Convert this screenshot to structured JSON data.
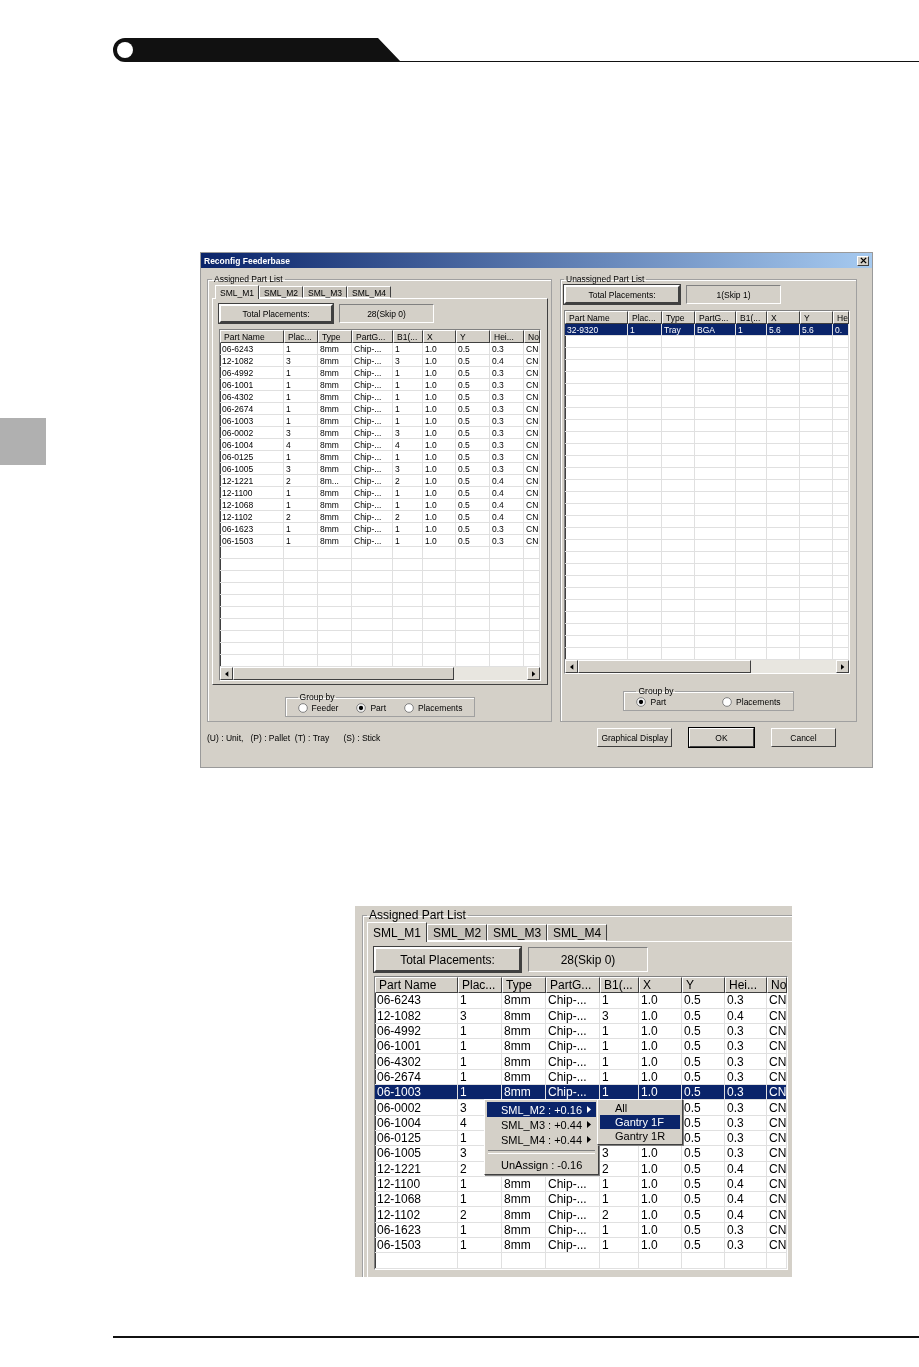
{
  "dialog": {
    "title": "Reconfig Feederbase",
    "assigned": {
      "legend": "Assigned Part List",
      "tabs": [
        {
          "label": "SML_M1",
          "selected": true
        },
        {
          "label": "SML_M2",
          "selected": false
        },
        {
          "label": "SML_M3",
          "selected": false
        },
        {
          "label": "SML_M4",
          "selected": false
        }
      ],
      "total_label": "Total Placements:",
      "total_value": "28(Skip 0)",
      "table": {
        "columns": [
          "Part Name",
          "Plac...",
          "Type",
          "PartG...",
          "B1(...",
          "X",
          "Y",
          "Hei...",
          "No"
        ],
        "rows": [
          {
            "cells": [
              "06-6243",
              "1",
              "8mm",
              "Chip-...",
              "1",
              "1.0",
              "0.5",
              "0.3",
              "CN"
            ],
            "selected": false
          },
          {
            "cells": [
              "12-1082",
              "3",
              "8mm",
              "Chip-...",
              "3",
              "1.0",
              "0.5",
              "0.4",
              "CN"
            ],
            "selected": false
          },
          {
            "cells": [
              "06-4992",
              "1",
              "8mm",
              "Chip-...",
              "1",
              "1.0",
              "0.5",
              "0.3",
              "CN"
            ],
            "selected": false
          },
          {
            "cells": [
              "06-1001",
              "1",
              "8mm",
              "Chip-...",
              "1",
              "1.0",
              "0.5",
              "0.3",
              "CN"
            ],
            "selected": false
          },
          {
            "cells": [
              "06-4302",
              "1",
              "8mm",
              "Chip-...",
              "1",
              "1.0",
              "0.5",
              "0.3",
              "CN"
            ],
            "selected": false
          },
          {
            "cells": [
              "06-2674",
              "1",
              "8mm",
              "Chip-...",
              "1",
              "1.0",
              "0.5",
              "0.3",
              "CN"
            ],
            "selected": false
          },
          {
            "cells": [
              "06-1003",
              "1",
              "8mm",
              "Chip-...",
              "1",
              "1.0",
              "0.5",
              "0.3",
              "CN"
            ],
            "selected": false
          },
          {
            "cells": [
              "06-0002",
              "3",
              "8mm",
              "Chip-...",
              "3",
              "1.0",
              "0.5",
              "0.3",
              "CN"
            ],
            "selected": false
          },
          {
            "cells": [
              "06-1004",
              "4",
              "8mm",
              "Chip-...",
              "4",
              "1.0",
              "0.5",
              "0.3",
              "CN"
            ],
            "selected": false
          },
          {
            "cells": [
              "06-0125",
              "1",
              "8mm",
              "Chip-...",
              "1",
              "1.0",
              "0.5",
              "0.3",
              "CN"
            ],
            "selected": false
          },
          {
            "cells": [
              "06-1005",
              "3",
              "8mm",
              "Chip-...",
              "3",
              "1.0",
              "0.5",
              "0.3",
              "CN"
            ],
            "selected": false
          },
          {
            "cells": [
              "12-1221",
              "2",
              "8m...",
              "Chip-...",
              "2",
              "1.0",
              "0.5",
              "0.4",
              "CN"
            ],
            "selected": false
          },
          {
            "cells": [
              "12-1100",
              "1",
              "8mm",
              "Chip-...",
              "1",
              "1.0",
              "0.5",
              "0.4",
              "CN"
            ],
            "selected": false
          },
          {
            "cells": [
              "12-1068",
              "1",
              "8mm",
              "Chip-...",
              "1",
              "1.0",
              "0.5",
              "0.4",
              "CN"
            ],
            "selected": false
          },
          {
            "cells": [
              "12-1102",
              "2",
              "8mm",
              "Chip-...",
              "2",
              "1.0",
              "0.5",
              "0.4",
              "CN"
            ],
            "selected": false
          },
          {
            "cells": [
              "06-1623",
              "1",
              "8mm",
              "Chip-...",
              "1",
              "1.0",
              "0.5",
              "0.3",
              "CN"
            ],
            "selected": false
          },
          {
            "cells": [
              "06-1503",
              "1",
              "8mm",
              "Chip-...",
              "1",
              "1.0",
              "0.5",
              "0.3",
              "CN"
            ],
            "selected": false
          }
        ]
      },
      "group_by": {
        "legend": "Group by",
        "options": [
          {
            "label": "Feeder",
            "selected": false
          },
          {
            "label": "Part",
            "selected": true
          },
          {
            "label": "Placements",
            "selected": false
          }
        ]
      }
    },
    "unassigned": {
      "legend": "Unassigned Part List",
      "total_label": "Total Placements:",
      "total_value": "1(Skip 1)",
      "table": {
        "columns": [
          "Part Name",
          "Plac...",
          "Type",
          "PartG...",
          "B1(...",
          "X",
          "Y",
          "He"
        ],
        "rows": [
          {
            "cells": [
              "32-9320",
              "1",
              "Tray",
              "BGA",
              "1",
              "5.6",
              "5.6",
              "0."
            ],
            "selected": true
          }
        ]
      },
      "group_by": {
        "legend": "Group by",
        "options": [
          {
            "label": "Part",
            "selected": true
          },
          {
            "label": "Placements",
            "selected": false
          }
        ]
      }
    },
    "legend_text": "(U) : Unit,   (P) : Pallet  (T) : Tray      (S) : Stick",
    "buttons": [
      {
        "label": "Graphical Display",
        "default": false
      },
      {
        "label": "OK",
        "default": true
      },
      {
        "label": "Cancel",
        "default": false
      }
    ]
  },
  "zoom_view": {
    "legend": "Assigned Part List",
    "tabs": [
      {
        "label": "SML_M1",
        "selected": true
      },
      {
        "label": "SML_M2",
        "selected": false
      },
      {
        "label": "SML_M3",
        "selected": false
      },
      {
        "label": "SML_M4",
        "selected": false
      }
    ],
    "total_label": "Total Placements:",
    "total_value": "28(Skip 0)",
    "table": {
      "columns": [
        "Part Name",
        "Plac...",
        "Type",
        "PartG...",
        "B1(...",
        "X",
        "Y",
        "Hei...",
        "No"
      ],
      "rows": [
        {
          "cells": [
            "06-6243",
            "1",
            "8mm",
            "Chip-...",
            "1",
            "1.0",
            "0.5",
            "0.3",
            "CN"
          ],
          "selected": false
        },
        {
          "cells": [
            "12-1082",
            "3",
            "8mm",
            "Chip-...",
            "3",
            "1.0",
            "0.5",
            "0.4",
            "CN"
          ],
          "selected": false
        },
        {
          "cells": [
            "06-4992",
            "1",
            "8mm",
            "Chip-...",
            "1",
            "1.0",
            "0.5",
            "0.3",
            "CN"
          ],
          "selected": false
        },
        {
          "cells": [
            "06-1001",
            "1",
            "8mm",
            "Chip-...",
            "1",
            "1.0",
            "0.5",
            "0.3",
            "CN"
          ],
          "selected": false
        },
        {
          "cells": [
            "06-4302",
            "1",
            "8mm",
            "Chip-...",
            "1",
            "1.0",
            "0.5",
            "0.3",
            "CN"
          ],
          "selected": false
        },
        {
          "cells": [
            "06-2674",
            "1",
            "8mm",
            "Chip-...",
            "1",
            "1.0",
            "0.5",
            "0.3",
            "CN"
          ],
          "selected": false
        },
        {
          "cells": [
            "06-1003",
            "1",
            "8mm",
            "Chip-...",
            "1",
            "1.0",
            "0.5",
            "0.3",
            "CN"
          ],
          "selected": true
        },
        {
          "cells": [
            "06-0002",
            "3",
            null,
            null,
            null,
            null,
            "0.5",
            "0.3",
            "CN"
          ],
          "selected": false
        },
        {
          "cells": [
            "06-1004",
            "4",
            null,
            null,
            null,
            null,
            "0.5",
            "0.3",
            "CN"
          ],
          "selected": false
        },
        {
          "cells": [
            "06-0125",
            "1",
            null,
            null,
            null,
            null,
            "0.5",
            "0.3",
            "CN"
          ],
          "selected": false
        },
        {
          "cells": [
            "06-1005",
            "3",
            null,
            null,
            "3",
            "1.0",
            "0.5",
            "0.3",
            "CN"
          ],
          "selected": false
        },
        {
          "cells": [
            "12-1221",
            "2",
            null,
            null,
            "2",
            "1.0",
            "0.5",
            "0.4",
            "CN"
          ],
          "selected": false
        },
        {
          "cells": [
            "12-1100",
            "1",
            "8mm",
            "Chip-...",
            "1",
            "1.0",
            "0.5",
            "0.4",
            "CN"
          ],
          "selected": false
        },
        {
          "cells": [
            "12-1068",
            "1",
            "8mm",
            "Chip-...",
            "1",
            "1.0",
            "0.5",
            "0.4",
            "CN"
          ],
          "selected": false
        },
        {
          "cells": [
            "12-1102",
            "2",
            "8mm",
            "Chip-...",
            "2",
            "1.0",
            "0.5",
            "0.4",
            "CN"
          ],
          "selected": false
        },
        {
          "cells": [
            "06-1623",
            "1",
            "8mm",
            "Chip-...",
            "1",
            "1.0",
            "0.5",
            "0.3",
            "CN"
          ],
          "selected": false
        },
        {
          "cells": [
            "06-1503",
            "1",
            "8mm",
            "Chip-...",
            "1",
            "1.0",
            "0.5",
            "0.3",
            "CN"
          ],
          "selected": false
        }
      ]
    },
    "context_menu": {
      "items": [
        {
          "kind": "submenu",
          "label": "SML_M2 : +0.16",
          "selected": true
        },
        {
          "kind": "submenu",
          "label": "SML_M3 : +0.44",
          "selected": false
        },
        {
          "kind": "submenu",
          "label": "SML_M4 : +0.44",
          "selected": false
        },
        {
          "kind": "separator"
        },
        {
          "kind": "command",
          "label": "UnAssign : -0.16",
          "selected": false
        }
      ],
      "submenu": [
        {
          "label": "All",
          "selected": false
        },
        {
          "label": "Gantry 1F",
          "selected": true
        },
        {
          "label": "Gantry 1R",
          "selected": false
        }
      ]
    }
  }
}
